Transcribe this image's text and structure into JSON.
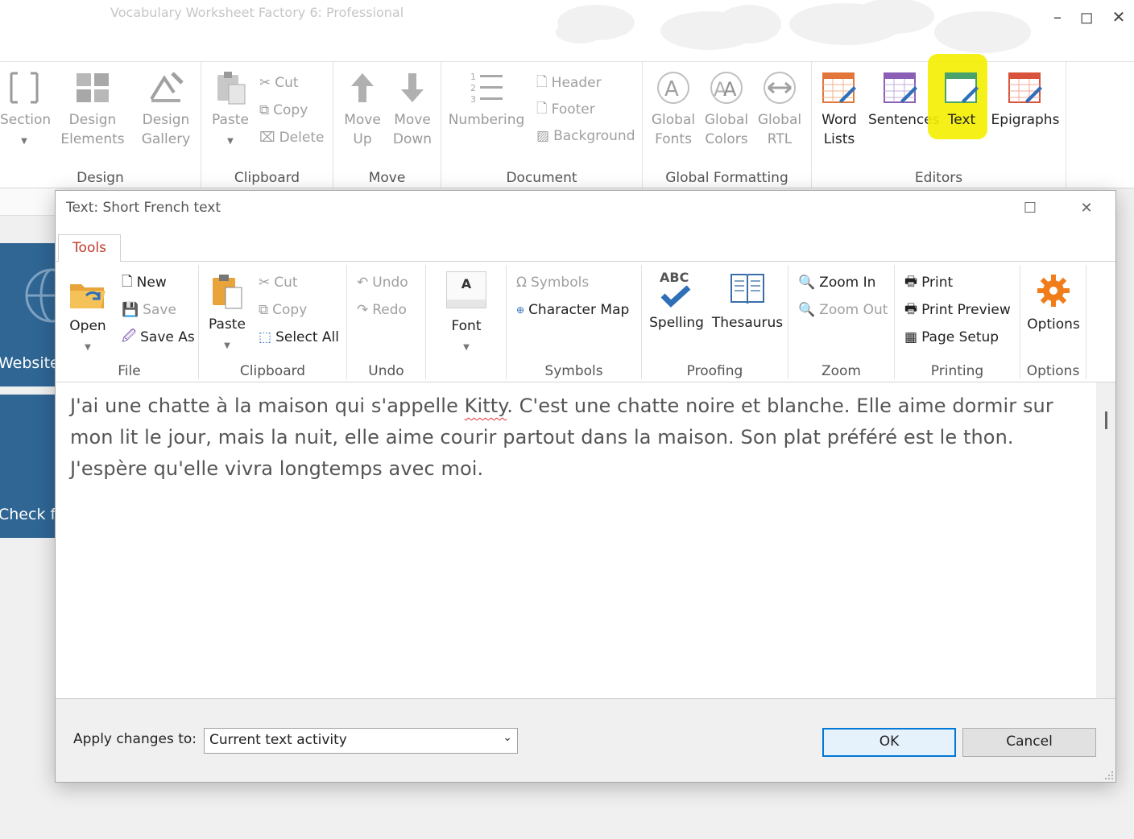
{
  "app": {
    "title": "Vocabulary Worksheet Factory 6: Professional",
    "minimize": "–",
    "maximize": "◻",
    "close": "✕"
  },
  "ribbon": {
    "design": {
      "label": "Design",
      "section": "Section",
      "design_elements": "Design Elements",
      "design_gallery": "Design Gallery"
    },
    "clipboard": {
      "label": "Clipboard",
      "paste": "Paste",
      "cut": "Cut",
      "copy": "Copy",
      "delete": "Delete"
    },
    "move": {
      "label": "Move",
      "up": "Move Up",
      "down": "Move Down"
    },
    "document": {
      "label": "Document",
      "numbering": "Numbering",
      "header": "Header",
      "footer": "Footer",
      "background": "Background"
    },
    "global": {
      "label": "Global Formatting",
      "fonts": "Global Fonts",
      "colors": "Global Colors",
      "rtl": "Global RTL"
    },
    "editors": {
      "label": "Editors",
      "word_lists": "Word Lists",
      "sentences": "Sentences",
      "text": "Text",
      "epigraphs": "Epigraphs"
    }
  },
  "left_panel": {
    "website": "Website",
    "check": "Check f"
  },
  "dialog": {
    "title": "Text:  Short French text",
    "tab": "Tools",
    "file": {
      "label": "File",
      "open": "Open",
      "new": "New",
      "save": "Save",
      "save_as": "Save As"
    },
    "clipboard": {
      "label": "Clipboard",
      "paste": "Paste",
      "cut": "Cut",
      "copy": "Copy",
      "select_all": "Select All"
    },
    "undo": {
      "label": "Undo",
      "undo": "Undo",
      "redo": "Redo"
    },
    "font": {
      "label": "Font",
      "glyph": "A"
    },
    "symbols": {
      "label": "Symbols",
      "symbols": "Symbols",
      "charmap": "Character Map"
    },
    "proofing": {
      "label": "Proofing",
      "spelling": "Spelling",
      "thesaurus": "Thesaurus",
      "abc": "ABC"
    },
    "zoom": {
      "label": "Zoom",
      "zoom_in": "Zoom In",
      "zoom_out": "Zoom Out"
    },
    "printing": {
      "label": "Printing",
      "print": "Print",
      "preview": "Print Preview",
      "page_setup": "Page Setup"
    },
    "options": {
      "label": "Options",
      "options": "Options"
    },
    "text": {
      "before": "J'ai une chatte à la maison qui s'appelle ",
      "misspelled": "Kitty",
      "after": ". C'est une chatte noire et blanche. Elle aime dormir sur mon lit le jour, mais la nuit, elle aime courir partout dans la maison. Son plat préféré est le thon. J'espère qu'elle vivra longtemps avec moi."
    },
    "apply_label": "Apply changes to:",
    "apply_value": "Current text activity",
    "ok": "OK",
    "cancel": "Cancel"
  }
}
